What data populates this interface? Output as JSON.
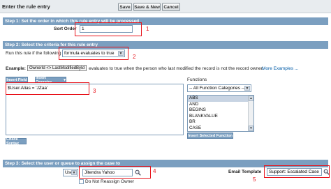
{
  "header": {
    "title": "Enter the rule entry",
    "save_label": "Save",
    "save_new_label": "Save & New",
    "cancel_label": "Cancel"
  },
  "step1": {
    "title": "Step 1: Set the order in which this rule entry will be processed",
    "sort_order_label": "Sort Order",
    "sort_order_value": "1",
    "marker": "1"
  },
  "step2": {
    "title": "Step 2: Select the criteria for this rule entry",
    "run_rule_label": "Run this rule if the following",
    "criteria_selected": "formula evaluates to true",
    "marker": "2",
    "example_label": "Example:",
    "example_code": "OwnerId <> LastModifiedById",
    "example_text": "evaluates to true when the person who last modified the record is not the record owner.",
    "more_examples": "More Examples ...",
    "insert_field": "Insert Field",
    "insert_operator": "Insert Operator",
    "formula_value": "$User.Alias = 'JZaa'",
    "formula_marker": "3",
    "functions_label": "Functions",
    "function_category": "-- All Function Categories --",
    "functions_list": [
      "ABS",
      "AND",
      "BEGINS",
      "BLANKVALUE",
      "BR",
      "CASE"
    ],
    "insert_selected_function": "Insert Selected Function",
    "check_syntax": "Check Syntax"
  },
  "step3": {
    "title": "Step 3: Select the user or queue to assign the case to",
    "assignee_type": "User",
    "assignee_value": "Jitendra Yahoo",
    "assignee_marker": "4",
    "do_not_reassign_label": "Do Not Reassign Owner",
    "email_template_label": "Email Template",
    "email_template_value": "Support: Escalated Case",
    "email_marker": "5"
  },
  "colors": {
    "step_bar": "#7b9fc0",
    "annotation": "#e8131b"
  }
}
